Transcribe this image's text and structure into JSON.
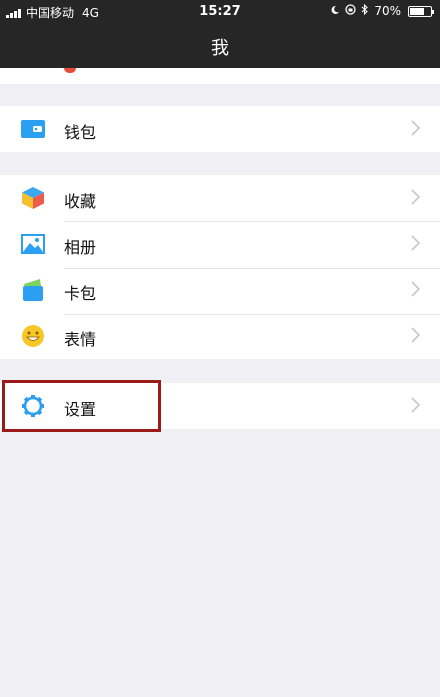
{
  "status_bar": {
    "carrier": "中国移动",
    "network": "4G",
    "time": "15:27",
    "battery": "70%",
    "battery_level": 0.7
  },
  "nav": {
    "title": "我"
  },
  "menu": {
    "wallet": {
      "label": "钱包",
      "icon": "wallet-icon"
    },
    "favorites": {
      "label": "收藏",
      "icon": "favorites-cube-icon"
    },
    "album": {
      "label": "相册",
      "icon": "album-picture-icon"
    },
    "cards": {
      "label": "卡包",
      "icon": "card-wallet-icon"
    },
    "stickers": {
      "label": "表情",
      "icon": "smiley-icon"
    },
    "settings": {
      "label": "设置",
      "icon": "gear-icon"
    }
  },
  "colors": {
    "nav_bg": "#262626",
    "page_bg": "#efeff4",
    "highlight": "#9b1b1b",
    "accent_blue": "#2b9ff1"
  }
}
